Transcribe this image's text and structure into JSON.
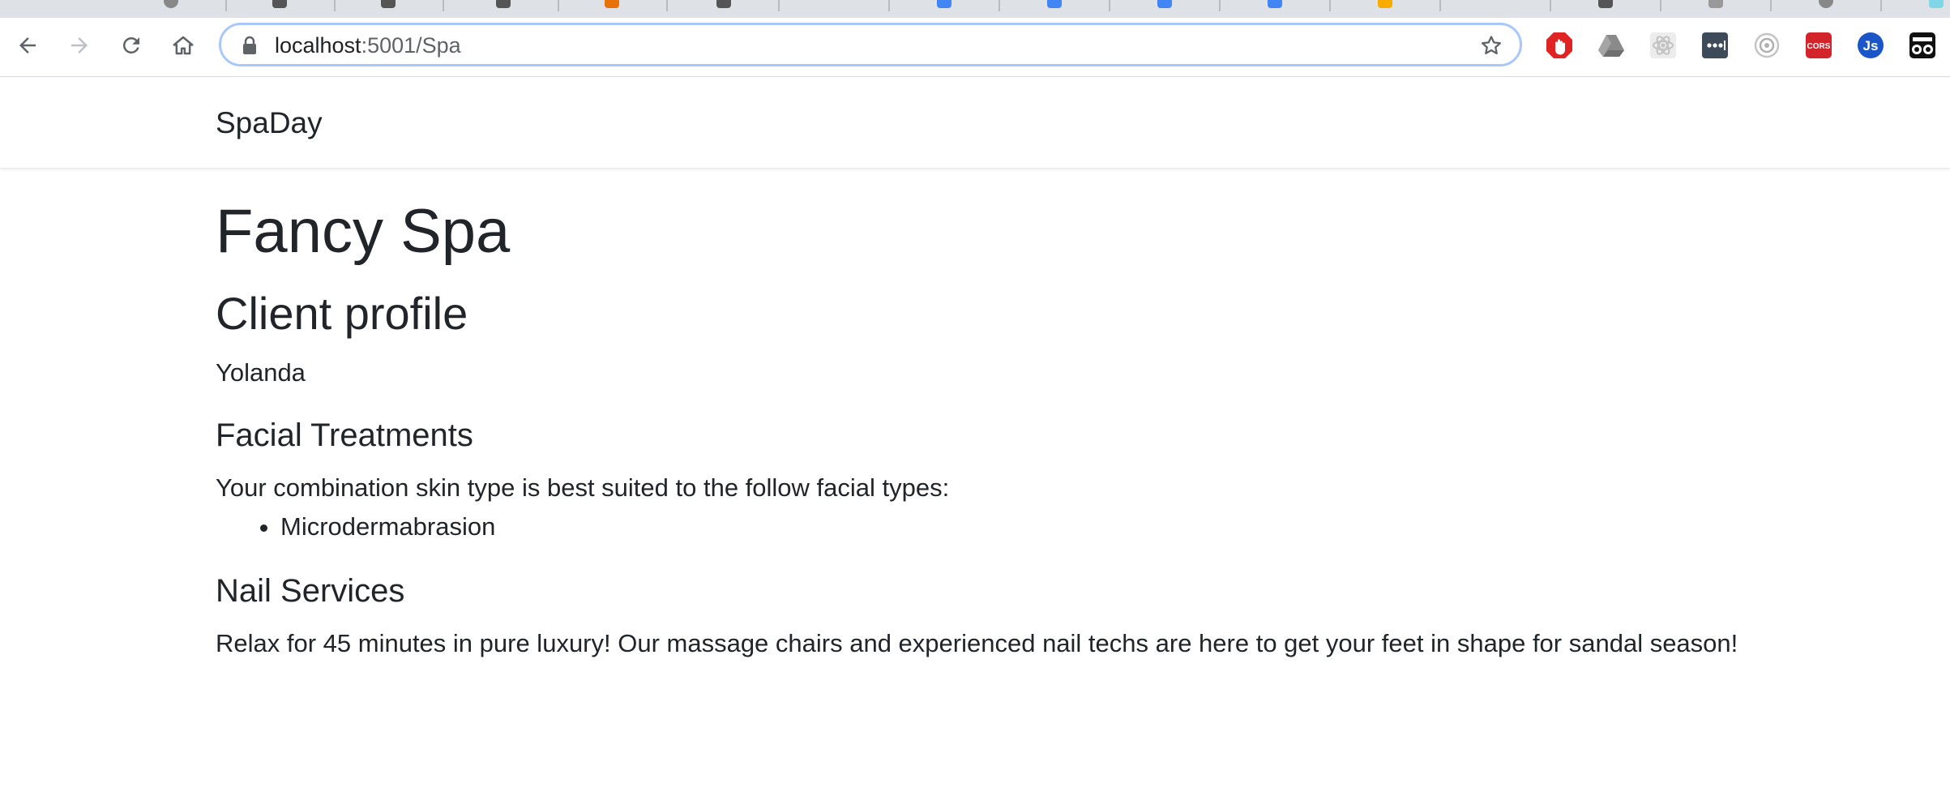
{
  "browser": {
    "url_host": "localhost",
    "url_path": ":5001/Spa"
  },
  "site": {
    "brand": "SpaDay"
  },
  "page": {
    "title": "Fancy Spa",
    "subtitle": "Client profile",
    "client_name": "Yolanda",
    "facial": {
      "heading": "Facial Treatments",
      "intro": "Your combination skin type is best suited to the follow facial types:",
      "items": [
        "Microdermabrasion"
      ]
    },
    "nails": {
      "heading": "Nail Services",
      "text": "Relax for 45 minutes in pure luxury! Our massage chairs and experienced nail techs are here to get your feet in shape for sandal season!"
    }
  },
  "extensions": [
    {
      "icon": "adblock-icon",
      "color": "#e02424"
    },
    {
      "icon": "google-drive-icon",
      "color": "#8a8a8a"
    },
    {
      "icon": "react-devtools-icon",
      "color": "#c7c7c7"
    },
    {
      "icon": "more-dots-extension-icon",
      "color": "#3c4a5a"
    },
    {
      "icon": "target-extension-icon",
      "color": "#b0b0b0"
    },
    {
      "icon": "cors-extension-icon",
      "color": "#d3242c"
    },
    {
      "icon": "js-extension-icon",
      "color": "#1a56c7"
    },
    {
      "icon": "incognito-extension-icon",
      "color": "#111111"
    }
  ]
}
